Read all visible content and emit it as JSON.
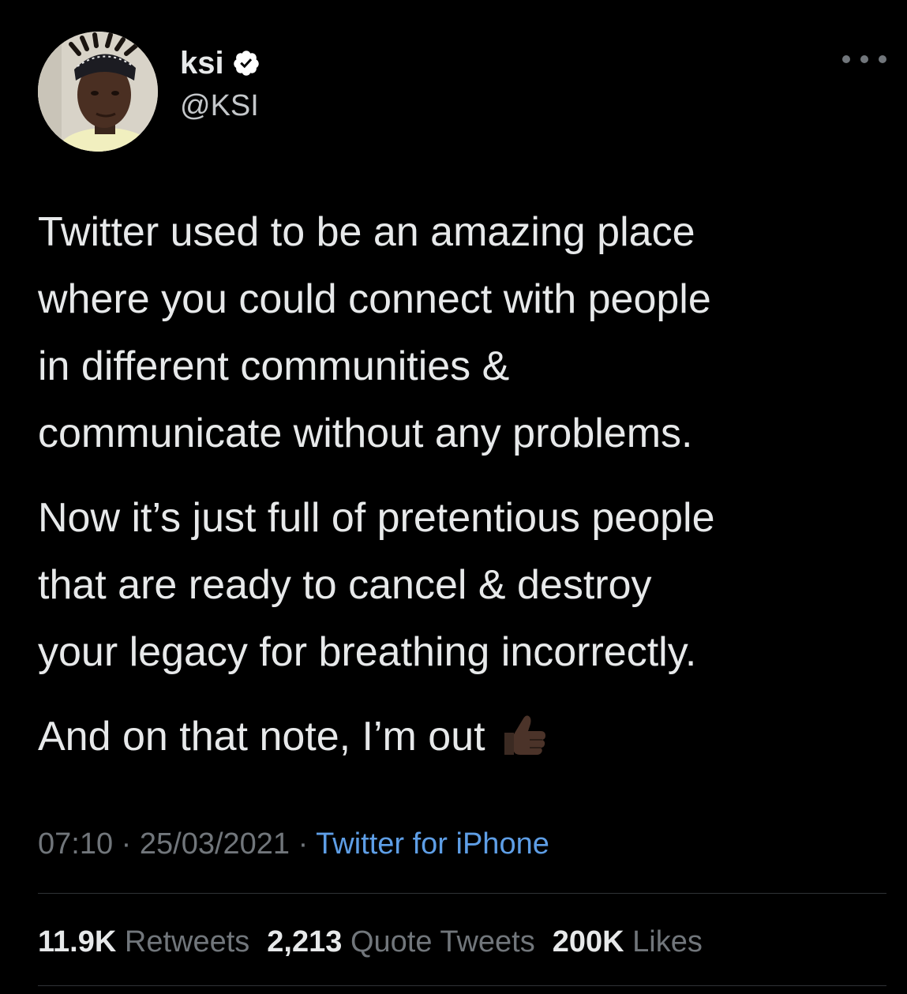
{
  "colors": {
    "background": "#000000",
    "text_primary": "#e7e9ea",
    "text_secondary": "#71767b",
    "link": "#5e9ee6",
    "verified_badge": "#ffffff",
    "divider": "#2f3336"
  },
  "author": {
    "display_name": "ksi",
    "handle": "@KSI",
    "verified": true,
    "avatar_icon": "profile-photo"
  },
  "tweet": {
    "paragraphs": [
      {
        "lines": [
          "Twitter used to be an amazing place",
          "where you could connect with people",
          "in different communities &",
          "communicate without any problems."
        ]
      },
      {
        "lines": [
          "Now it’s just full of pretentious people",
          "that are ready to cancel & destroy",
          "your legacy for breathing incorrectly."
        ]
      },
      {
        "lines": [
          "And on that note, I’m out"
        ],
        "trailing_emoji": "thumbs-up-dark-skin-tone"
      }
    ]
  },
  "meta": {
    "time": "07:10",
    "separator": " · ",
    "date": "25/03/2021",
    "source": "Twitter for iPhone"
  },
  "stats": {
    "retweets": {
      "value": "11.9K",
      "label": "Retweets"
    },
    "quote_tweets": {
      "value": "2,213",
      "label": "Quote Tweets"
    },
    "likes": {
      "value": "200K",
      "label": "Likes"
    }
  }
}
